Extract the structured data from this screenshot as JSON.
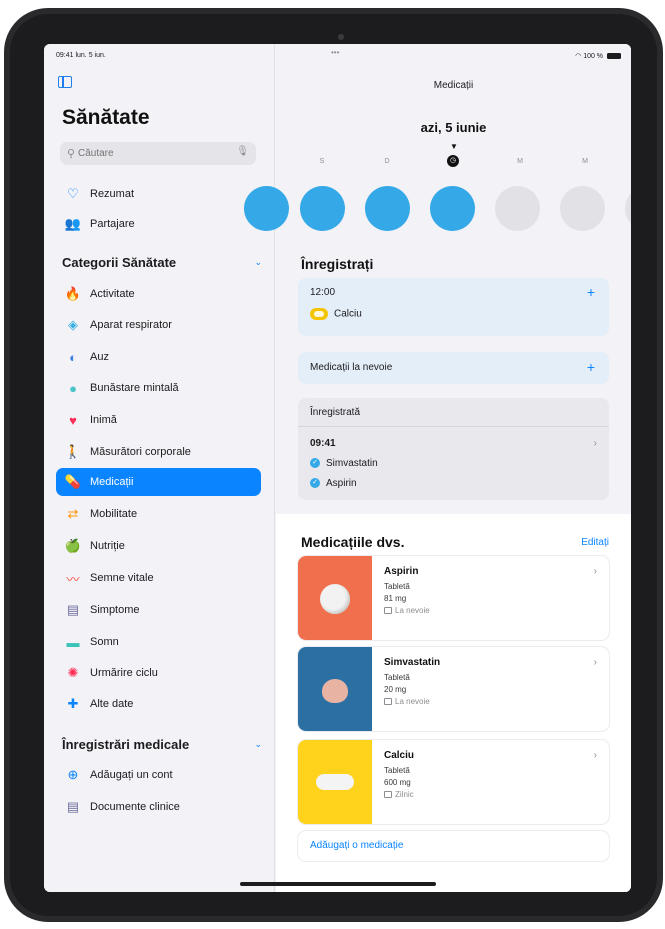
{
  "status": {
    "time_date": "09:41 lun. 5 iun.",
    "dots": "•••",
    "battery": "100 %"
  },
  "sidebar": {
    "title": "Sănătate",
    "search_placeholder": "Căutare",
    "top_items": [
      {
        "label": "Rezumat",
        "icon": "heart-outline-icon"
      },
      {
        "label": "Partajare",
        "icon": "people-icon"
      }
    ],
    "categories_header": "Categorii Sănătate",
    "categories": [
      {
        "label": "Activitate",
        "icon": "flame-icon",
        "color": "#ff6b2c"
      },
      {
        "label": "Aparat respirator",
        "icon": "lungs-icon",
        "color": "#3ab0e2"
      },
      {
        "label": "Auz",
        "icon": "ear-icon",
        "color": "#3a7fe0"
      },
      {
        "label": "Bunăstare mintală",
        "icon": "mind-icon",
        "color": "#4cc3c9"
      },
      {
        "label": "Inimă",
        "icon": "heart-icon",
        "color": "#ff2d55"
      },
      {
        "label": "Măsurători corporale",
        "icon": "figure-icon",
        "color": "#af52de"
      },
      {
        "label": "Medicații",
        "icon": "pills-icon",
        "color": "#ffffff",
        "active": true
      },
      {
        "label": "Mobilitate",
        "icon": "arrows-icon",
        "color": "#ff9500"
      },
      {
        "label": "Nutriție",
        "icon": "apple-icon",
        "color": "#34c759"
      },
      {
        "label": "Semne vitale",
        "icon": "waveform-icon",
        "color": "#ff3b30"
      },
      {
        "label": "Simptome",
        "icon": "clipboard-icon",
        "color": "#6e6e9e"
      },
      {
        "label": "Somn",
        "icon": "bed-icon",
        "color": "#3ac3b8"
      },
      {
        "label": "Urmărire ciclu",
        "icon": "cycle-icon",
        "color": "#ff2d55"
      },
      {
        "label": "Alte date",
        "icon": "plus-icon",
        "color": "#0a84ff"
      }
    ],
    "records_header": "Înregistrări medicale",
    "records": [
      {
        "label": "Adăugați un cont",
        "icon": "add-circle-icon",
        "color": "#0a84ff"
      },
      {
        "label": "Documente clinice",
        "icon": "document-icon",
        "color": "#6e6e9e"
      }
    ]
  },
  "main": {
    "nav_title": "Medicații",
    "date_title": "azi, 5 iunie",
    "weekdays": [
      "S",
      "D",
      "L",
      "M",
      "M"
    ],
    "day_states": [
      "done",
      "done",
      "done",
      "done",
      "empty",
      "empty",
      "empty"
    ],
    "log_header": "Înregistrați",
    "scheduled_time": "12:00",
    "scheduled_med": "Calciu",
    "as_needed_label": "Medicații la nevoie",
    "logged_header": "Înregistrată",
    "logged_time": "09:41",
    "logged_meds": [
      "Simvastatin",
      "Aspirin"
    ],
    "your_meds_header": "Medicațiile dvs.",
    "edit_label": "Editați",
    "meds": [
      {
        "name": "Aspirin",
        "form": "Tabletă",
        "dose": "81 mg",
        "schedule": "La nevoie",
        "bg": "#f0704e"
      },
      {
        "name": "Simvastatin",
        "form": "Tabletă",
        "dose": "20 mg",
        "schedule": "La nevoie",
        "bg": "#2b6fa3"
      },
      {
        "name": "Calciu",
        "form": "Tabletă",
        "dose": "600 mg",
        "schedule": "Zilnic",
        "bg": "#ffd21c"
      }
    ],
    "add_med_label": "Adăugați o medicație"
  }
}
